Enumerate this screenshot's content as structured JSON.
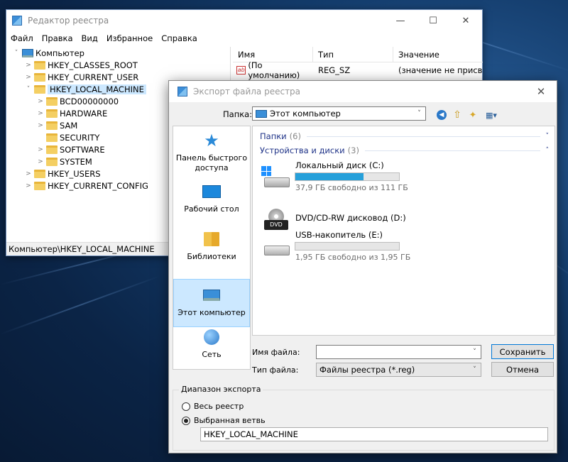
{
  "regedit": {
    "title": "Редактор реестра",
    "menu": [
      "Файл",
      "Правка",
      "Вид",
      "Избранное",
      "Справка"
    ],
    "tree": [
      {
        "label": "Компьютер",
        "level": 0,
        "icon": "computer-icon",
        "arrow": "˅"
      },
      {
        "label": "HKEY_CLASSES_ROOT",
        "level": 1,
        "icon": "folder-icon",
        "arrow": ">"
      },
      {
        "label": "HKEY_CURRENT_USER",
        "level": 1,
        "icon": "folder-icon",
        "arrow": ">"
      },
      {
        "label": "HKEY_LOCAL_MACHINE",
        "level": 1,
        "icon": "folder-icon",
        "arrow": "˅",
        "selected": true
      },
      {
        "label": "BCD00000000",
        "level": 2,
        "icon": "folder-icon",
        "arrow": ">"
      },
      {
        "label": "HARDWARE",
        "level": 2,
        "icon": "folder-icon",
        "arrow": ">"
      },
      {
        "label": "SAM",
        "level": 2,
        "icon": "folder-icon",
        "arrow": ">"
      },
      {
        "label": "SECURITY",
        "level": 2,
        "icon": "folder-icon",
        "arrow": ""
      },
      {
        "label": "SOFTWARE",
        "level": 2,
        "icon": "folder-icon",
        "arrow": ">"
      },
      {
        "label": "SYSTEM",
        "level": 2,
        "icon": "folder-icon",
        "arrow": ">"
      },
      {
        "label": "HKEY_USERS",
        "level": 1,
        "icon": "folder-icon",
        "arrow": ">"
      },
      {
        "label": "HKEY_CURRENT_CONFIG",
        "level": 1,
        "icon": "folder-icon",
        "arrow": ">"
      }
    ],
    "columns": [
      "Имя",
      "Тип",
      "Значение"
    ],
    "values": [
      {
        "name": "(По умолчанию)",
        "type": "REG_SZ",
        "data": "(значение не присвоено)"
      }
    ],
    "status": "Компьютер\\HKEY_LOCAL_MACHINE"
  },
  "export": {
    "title": "Экспорт файла реестра",
    "look_in_label": "Папка:",
    "look_in_value": "Этот компьютер",
    "places": [
      {
        "label": "Панель быстрого доступа",
        "icon": "quick-access-star-icon"
      },
      {
        "label": "Рабочий стол",
        "icon": "desktop-icon"
      },
      {
        "label": "Библиотеки",
        "icon": "libraries-icon"
      },
      {
        "label": "Этот компьютер",
        "icon": "this-pc-icon",
        "active": true
      },
      {
        "label": "Сеть",
        "icon": "network-icon"
      }
    ],
    "groups": [
      {
        "name": "Папки",
        "count": "(6)",
        "chevron": "˅"
      },
      {
        "name": "Устройства и диски",
        "count": "(3)",
        "chevron": "˄"
      }
    ],
    "drives": [
      {
        "name": "Локальный диск (C:)",
        "free": "37,9 ГБ свободно из 111 ГБ",
        "used_fraction": 0.66,
        "icon": "local-disk-icon"
      },
      {
        "name": "DVD/CD-RW дисковод (D:)",
        "free": "",
        "icon": "dvd-drive-icon"
      },
      {
        "name": "USB-накопитель (E:)",
        "free": "1,95 ГБ свободно из 1,95 ГБ",
        "used_fraction": 0.0,
        "icon": "usb-drive-icon"
      }
    ],
    "filename_label": "Имя файла:",
    "filename_value": "",
    "filetype_label": "Тип файла:",
    "filetype_value": "Файлы реестра (*.reg)",
    "save_label": "Сохранить",
    "cancel_label": "Отмена",
    "range_label": "Диапазон экспорта",
    "radio_all": "Весь реестр",
    "radio_branch": "Выбранная ветвь",
    "branch_value": "HKEY_LOCAL_MACHINE"
  }
}
